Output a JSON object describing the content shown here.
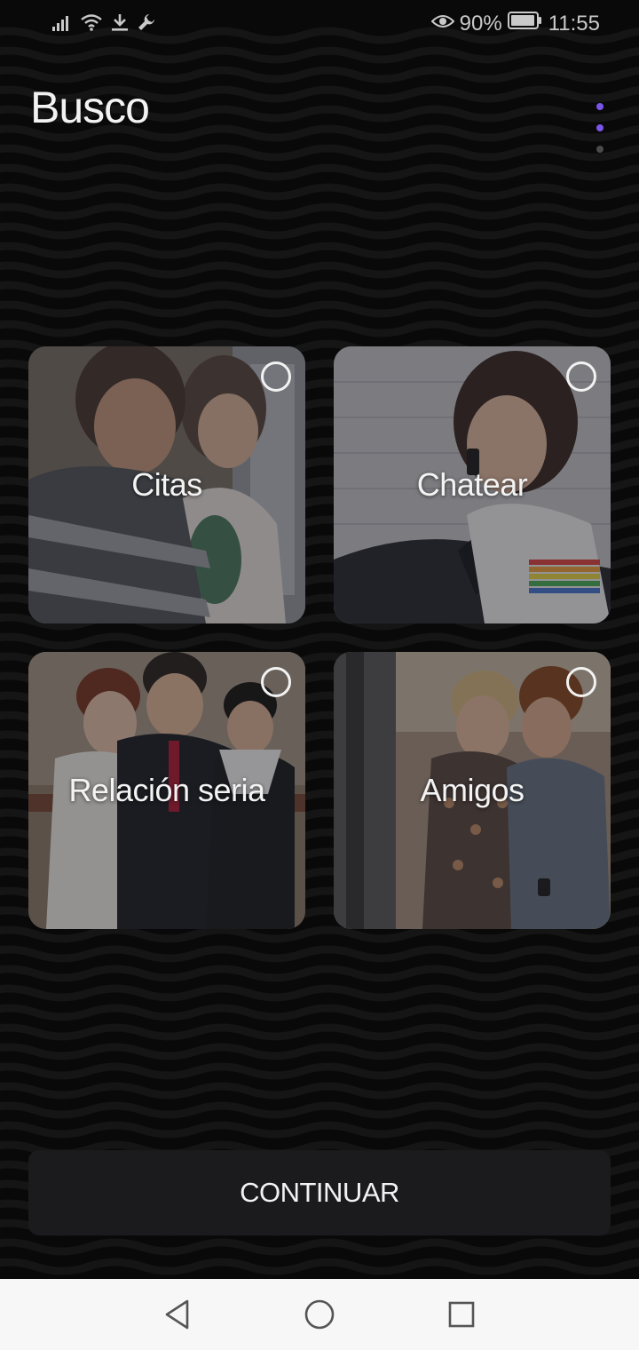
{
  "status_bar": {
    "battery": "90%",
    "time": "11:55",
    "left_icons": [
      "signal-icon",
      "wifi-icon",
      "download-icon",
      "wrench-icon"
    ],
    "right_icons": [
      "eye-icon",
      "battery-icon"
    ]
  },
  "header": {
    "title": "Busco",
    "step_dots": [
      {
        "state": "active",
        "color": "#7a55e8"
      },
      {
        "state": "active",
        "color": "#7a55e8"
      },
      {
        "state": "inactive",
        "color": "#4a4a4a"
      }
    ]
  },
  "options": [
    {
      "label": "Citas",
      "selected": false
    },
    {
      "label": "Chatear",
      "selected": false
    },
    {
      "label": "Relación seria",
      "selected": false
    },
    {
      "label": "Amigos",
      "selected": false
    }
  ],
  "continue_label": "CONTINUAR",
  "nav_bar": {
    "buttons": [
      "back-icon",
      "home-icon",
      "recents-icon"
    ]
  },
  "colors": {
    "background": "#090909",
    "accent": "#7a55e8",
    "button_bg": "#1b1b1d",
    "text": "#f2f2f2"
  }
}
